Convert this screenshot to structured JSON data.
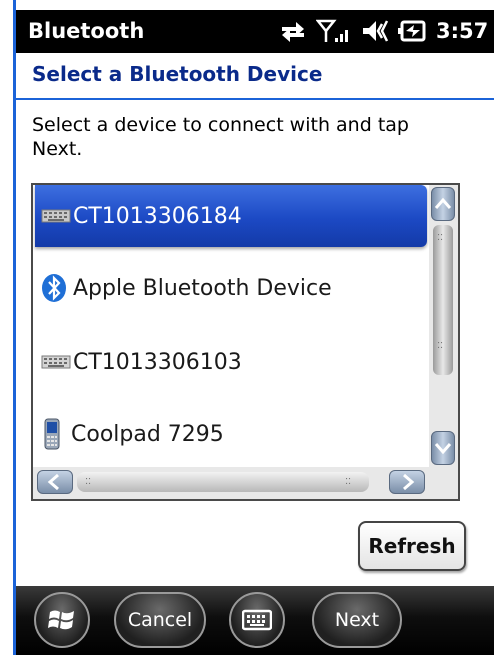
{
  "titlebar": {
    "app_title": "Bluetooth",
    "time": "3:57",
    "indicators": [
      "connectivity-icon",
      "signal-icon",
      "volume-icon",
      "battery-charging-icon"
    ]
  },
  "page": {
    "title": "Select a Bluetooth Device",
    "instructions": "Select a device to connect with and tap Next."
  },
  "devices": [
    {
      "label": "CT1013306184",
      "icon": "keyboard-device-icon",
      "selected": true
    },
    {
      "label": "Apple Bluetooth Device",
      "icon": "bluetooth-icon",
      "selected": false
    },
    {
      "label": "CT1013306103",
      "icon": "keyboard-device-icon",
      "selected": false
    },
    {
      "label": "Coolpad 7295",
      "icon": "phone-device-icon",
      "selected": false
    }
  ],
  "buttons": {
    "refresh": "Refresh"
  },
  "softkeys": {
    "start_icon": "windows-start-icon",
    "left": "Cancel",
    "keyboard_icon": "keyboard-icon",
    "right": "Next"
  },
  "colors": {
    "accent": "#1b63d8",
    "selection": "#1c49c4",
    "title_text": "#0a2a8a"
  }
}
